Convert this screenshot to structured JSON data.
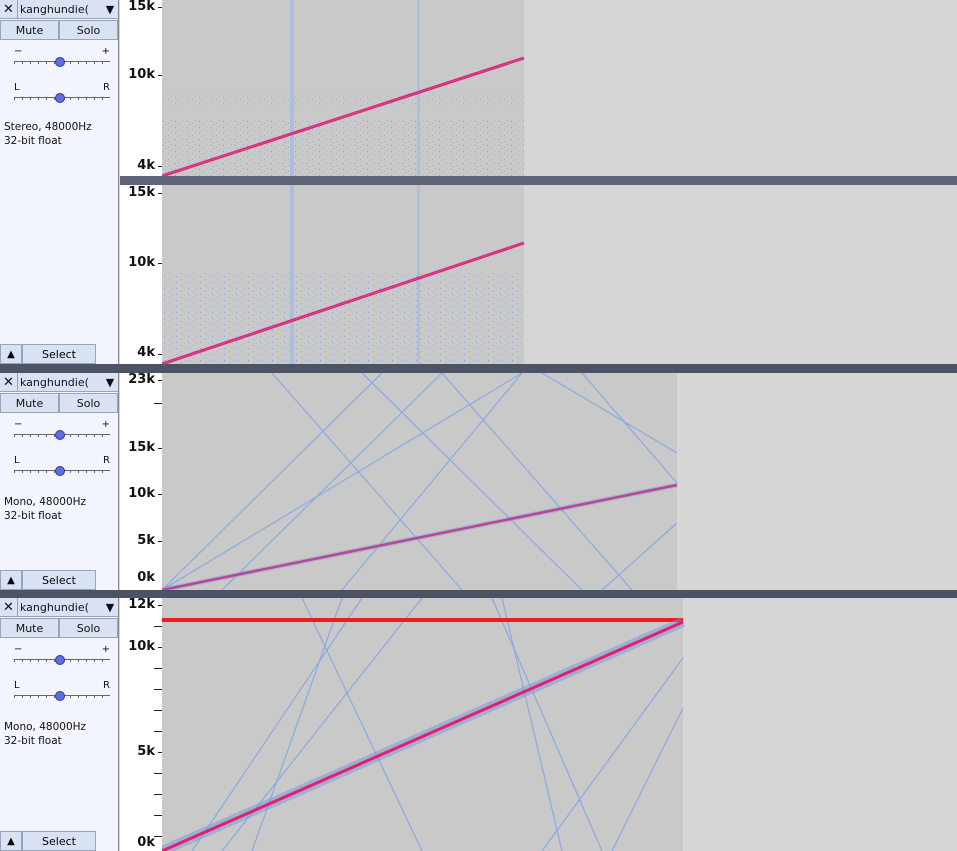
{
  "tracks": [
    {
      "name": "kanghundie(",
      "mute_label": "Mute",
      "solo_label": "Solo",
      "gain_minus": "−",
      "gain_plus": "+",
      "pan_left": "L",
      "pan_right": "R",
      "format_line1": "Stereo, 48000Hz",
      "format_line2": "32-bit float",
      "select_label": "Select",
      "channel1_ticks": [
        "15k",
        "10k",
        "4k"
      ],
      "channel2_ticks": [
        "15k",
        "10k",
        "4k"
      ]
    },
    {
      "name": "kanghundie(",
      "mute_label": "Mute",
      "solo_label": "Solo",
      "gain_minus": "−",
      "gain_plus": "+",
      "pan_left": "L",
      "pan_right": "R",
      "format_line1": "Mono, 48000Hz",
      "format_line2": "32-bit float",
      "select_label": "Select",
      "ticks": [
        "23k",
        "15k",
        "10k",
        "5k",
        "0k"
      ]
    },
    {
      "name": "kanghundie(",
      "mute_label": "Mute",
      "solo_label": "Solo",
      "gain_minus": "−",
      "gain_plus": "+",
      "pan_left": "L",
      "pan_right": "R",
      "format_line1": "Mono, 48000Hz",
      "format_line2": "32-bit float",
      "select_label": "Select",
      "ticks": [
        "12k",
        "10k",
        "5k",
        "0k"
      ]
    }
  ],
  "icons": {
    "close": "close-icon",
    "menu": "dropdown-arrow-icon",
    "collapse": "collapse-arrow-icon"
  },
  "colors": {
    "panel_bg": "#f2f5fd",
    "button_bg": "#d9e2f2",
    "spectrogram_bg": "#c9c9c9",
    "empty_bg": "#d6d6d6",
    "separator": "#4b5364",
    "noise": "#7fa5e6",
    "chirp": "#e0206a"
  }
}
